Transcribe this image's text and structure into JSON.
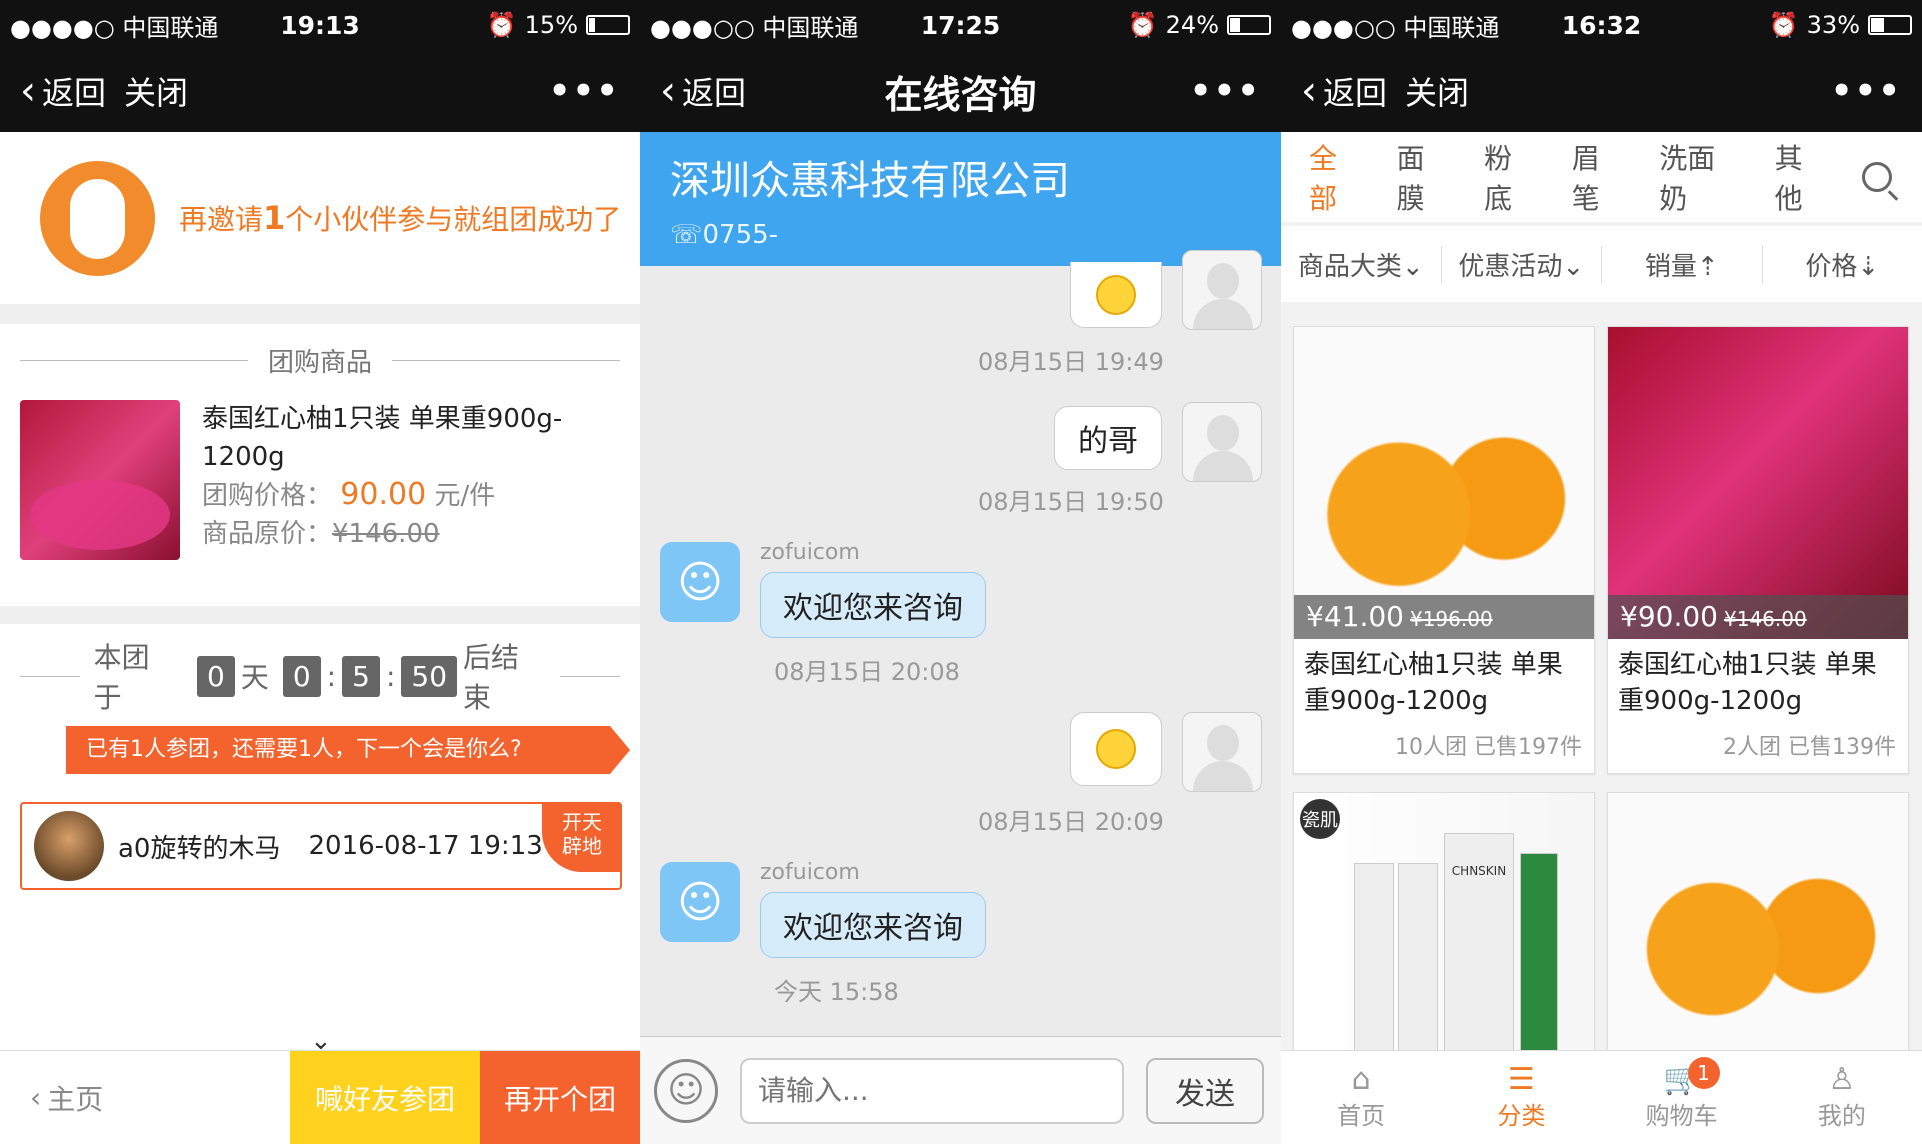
{
  "screen1": {
    "status": {
      "carrier": "●●●●○ 中国联通",
      "time": "19:13",
      "battery": "15%",
      "battery_level": 0.15
    },
    "nav": {
      "back": "返回",
      "close": "关闭",
      "more": "•••"
    },
    "invite": {
      "pre": "再邀请",
      "num": "1",
      "post": "个小伙伴参与就组团成功了"
    },
    "section_title": "团购商品",
    "product": {
      "name": "泰国红心柚1只装 单果重900g-1200g",
      "price_label": "团购价格：",
      "price": "90.00",
      "price_unit": "元/件",
      "orig_label": "商品原价：",
      "orig_price": "¥146.00"
    },
    "countdown": {
      "pre": "本团于",
      "days": "0",
      "day_unit": "天",
      "h": "0",
      "m": "5",
      "s": "50",
      "post": "后结束",
      "sep": ":"
    },
    "ribbon": "已有1人参团，还需要1人，下一个会是你么?",
    "member": {
      "name": "a0旋转的木马",
      "date": "2016-08-17 19:13",
      "badge_line1": "开天",
      "badge_line2": "辟地"
    },
    "chevron": "⌄",
    "bottom": {
      "home": "主页",
      "call_friends": "喊好友参团",
      "new_group": "再开个团"
    }
  },
  "screen2": {
    "status": {
      "carrier": "●●●○○ 中国联通",
      "time": "17:25",
      "battery": "24%",
      "battery_level": 0.24
    },
    "nav": {
      "back": "返回",
      "title": "在线咨询",
      "more": "•••"
    },
    "company": {
      "name": "深圳众惠科技有限公司",
      "phone": "0755-"
    },
    "messages": {
      "t1": "08月15日 19:49",
      "m2": "的哥",
      "t2": "08月15日 19:50",
      "sender1": "zofuicom",
      "m3": "欢迎您来咨询",
      "t3": "08月15日 20:08",
      "t4": "08月15日 20:09",
      "sender2": "zofuicom",
      "m5": "欢迎您来咨询",
      "t5": "今天 15:58"
    },
    "input": {
      "placeholder": "请输入...",
      "send": "发送"
    }
  },
  "screen3": {
    "status": {
      "carrier": "●●●○○ 中国联通",
      "time": "16:32",
      "battery": "33%",
      "battery_level": 0.33
    },
    "nav": {
      "back": "返回",
      "close": "关闭",
      "more": "•••"
    },
    "tabs": [
      "全部",
      "面膜",
      "粉底",
      "眉笔",
      "洗面奶",
      "其他"
    ],
    "filters": [
      "商品大类",
      "优惠活动",
      "销量",
      "价格"
    ],
    "products": [
      {
        "price": "¥41.00",
        "orig": "¥196.00",
        "name": "泰国红心柚1只装 单果重900g-1200g",
        "meta": "10人团  已售197件"
      },
      {
        "price": "¥90.00",
        "orig": "¥146.00",
        "name": "泰国红心柚1只装 单果重900g-1200g",
        "meta": "2人团  已售139件"
      }
    ],
    "card3_tag": "瓷肌",
    "brand": "CHNSKIN",
    "nav_items": [
      "首页",
      "分类",
      "购物车",
      "我的"
    ],
    "cart_count": "1"
  },
  "colors": {
    "accent": "#f07a24",
    "blue": "#3fa5ef",
    "yellow": "#ffd21e"
  }
}
